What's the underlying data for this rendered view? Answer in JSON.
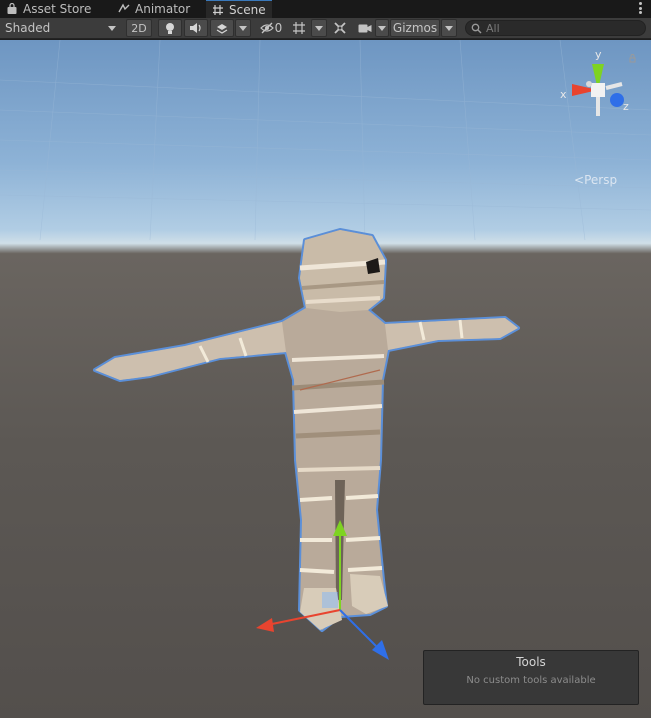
{
  "tabs": [
    {
      "label": "Asset Store",
      "icon": "bag-icon"
    },
    {
      "label": "Animator",
      "icon": "animator-icon"
    },
    {
      "label": "Scene",
      "icon": "scene-grid-icon",
      "active": true
    }
  ],
  "toolbar": {
    "draw_mode": "Shaded",
    "mode_2d": "2D",
    "hidden_count": "0",
    "gizmos": "Gizmos",
    "search_placeholder": "All"
  },
  "gizmo": {
    "x_label": "x",
    "y_label": "y",
    "z_label": "z",
    "projection": "Persp"
  },
  "tools_overlay": {
    "title": "Tools",
    "subtitle": "No custom tools available"
  },
  "colors": {
    "axis_x": "#e8442f",
    "axis_y": "#7ed321",
    "axis_z": "#2f6fe8",
    "selection_outline": "#5b8fd8"
  }
}
